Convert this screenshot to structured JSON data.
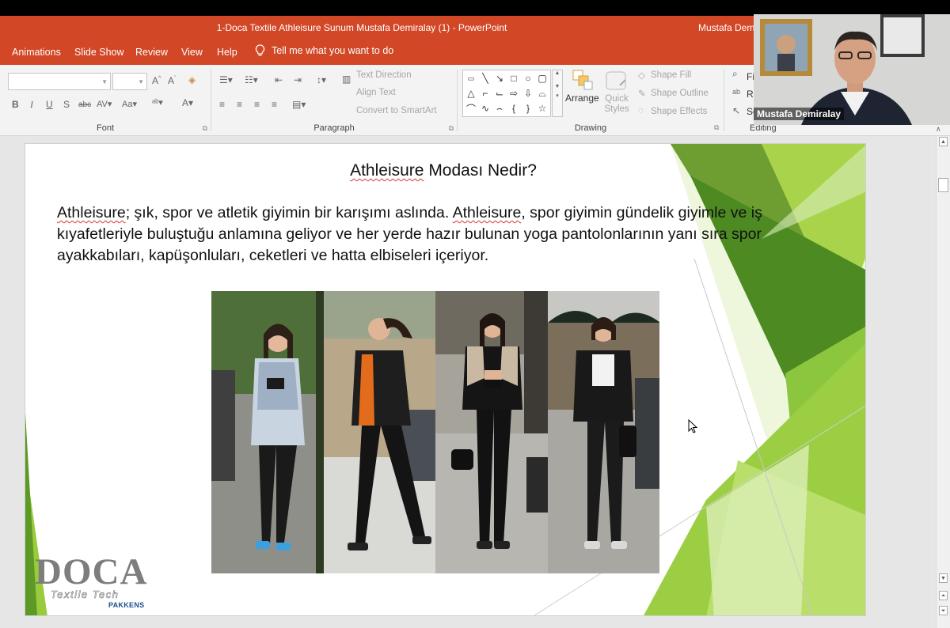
{
  "window": {
    "title": "1-Doca Textile Athleisure Sunum Mustafa Demiralay (1)  -  PowerPoint",
    "user": "Mustafa Demi"
  },
  "menu": {
    "tabs": [
      "Animations",
      "Slide Show",
      "Review",
      "View",
      "Help"
    ],
    "tell_me": "Tell me what you want to do"
  },
  "ribbon": {
    "font_group": "Font",
    "paragraph_group": "Paragraph",
    "drawing_group": "Drawing",
    "editing_group": "Editing",
    "text_direction": "Text Direction",
    "align_text": "Align Text",
    "convert_smartart": "Convert to SmartArt",
    "arrange": "Arrange",
    "quick_styles_1": "Quick",
    "quick_styles_2": "Styles",
    "shape_fill": "Shape Fill",
    "shape_outline": "Shape Outline",
    "shape_effects": "Shape Effects",
    "find": "Fi",
    "replace": "R",
    "select": "Se"
  },
  "slide": {
    "title_word": "Athleisure",
    "title_rest": " Modası Nedir?",
    "body_w1": "Athleisure",
    "body_p1": "; şık, spor ve atletik giyimin bir karışımı aslında. ",
    "body_w2": "Athleisure",
    "body_p2": ", spor giyimin gündelik giyimle ve iş kıyafetleriyle buluştuğu anlamına geliyor ve her yerde hazır bulunan yoga pantolonlarının yanı sıra spor ayakkabıları, kapüşonluları, ceketleri ve hatta elbiseleri içeriyor.",
    "logo_main": "DOCA",
    "logo_sub": "Textile Tech",
    "logo_brand": "PAKKENS"
  },
  "video": {
    "participant_name": "Mustafa Demiralay"
  },
  "colors": {
    "accent": "#d24726",
    "green_dark": "#4e8a1e",
    "green_light": "#9acb3c"
  }
}
